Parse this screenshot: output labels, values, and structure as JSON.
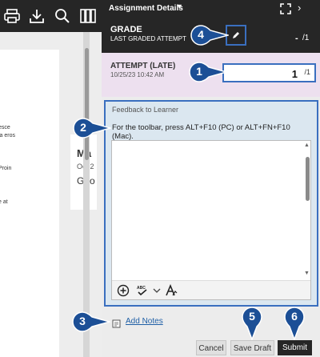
{
  "viewer": {
    "toolbar_icons": [
      "print-icon",
      "download-icon",
      "search-icon",
      "book-icon"
    ],
    "text_fragments": [
      "esce",
      "la eros",
      "Proin",
      "e at"
    ],
    "card": {
      "name": "Ma",
      "date": "Oct 2",
      "body": "Goo"
    }
  },
  "panel": {
    "title": "Assignment Details",
    "grade": {
      "title": "GRADE",
      "subtitle": "LAST GRADED ATTEMPT",
      "value": "-",
      "max": "/1"
    },
    "attempt": {
      "title": "ATTEMPT (LATE)",
      "date": "10/25/23 10:42 AM",
      "score": "1",
      "max": "/1"
    },
    "feedback": {
      "label": "Feedback to Learner",
      "hint": "For the toolbar, press ALT+F10 (PC) or ALT+FN+F10 (Mac).",
      "toolbar_icons": [
        "add-content-icon",
        "spellcheck-icon",
        "dropdown-icon",
        "accessibility-icon"
      ]
    },
    "add_notes_label": "Add Notes",
    "buttons": {
      "cancel": "Cancel",
      "save_draft": "Save Draft",
      "submit": "Submit"
    }
  },
  "callouts": [
    "1",
    "2",
    "3",
    "4",
    "5",
    "6"
  ],
  "colors": {
    "callout_blue": "#1c4f96",
    "focus_border": "#3a6fbf",
    "dark": "#262626",
    "attempt_bg": "#ede0ef"
  }
}
